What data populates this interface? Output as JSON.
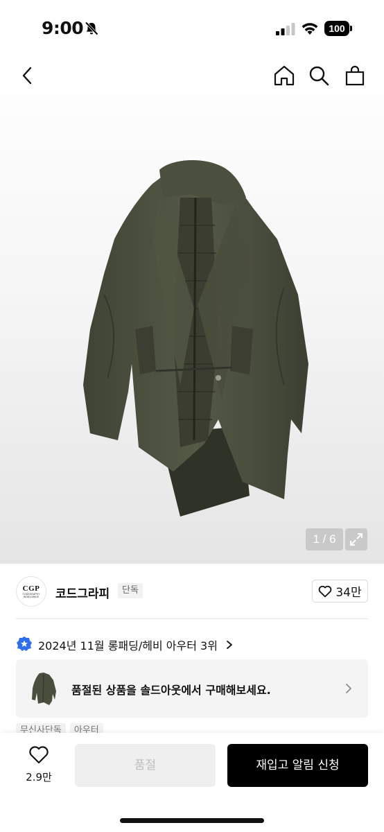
{
  "status_bar": {
    "time": "9:00",
    "battery": "100"
  },
  "nav": {
    "icons": [
      "back-chevron-icon",
      "home-icon",
      "search-icon",
      "shopping-bag-icon"
    ]
  },
  "gallery": {
    "page_indicator": "1 / 6",
    "image_subject": "coat-image"
  },
  "brand": {
    "logo_text": "CGP",
    "logo_subtext": "CODEGRAPHY WORLDWIDE",
    "name": "코드그라피",
    "badge": "단독",
    "like_count": "34만"
  },
  "ranking": {
    "text": "2024년 11월 롱패딩/헤비 아우터 3위"
  },
  "soldout_banner": {
    "text": "품절된 상품을 솔드아웃에서 구매해보세요."
  },
  "tags": [
    "무신사단독",
    "아우터"
  ],
  "bottom_bar": {
    "wish_count": "2.9만",
    "soldout_label": "품절",
    "restock_label": "재입고 알림 신청"
  },
  "colors": {
    "primary_button": "#000000",
    "disabled_button": "#efefef",
    "rank_badge": "#2f6fed",
    "coat": "#4a4e3d"
  }
}
